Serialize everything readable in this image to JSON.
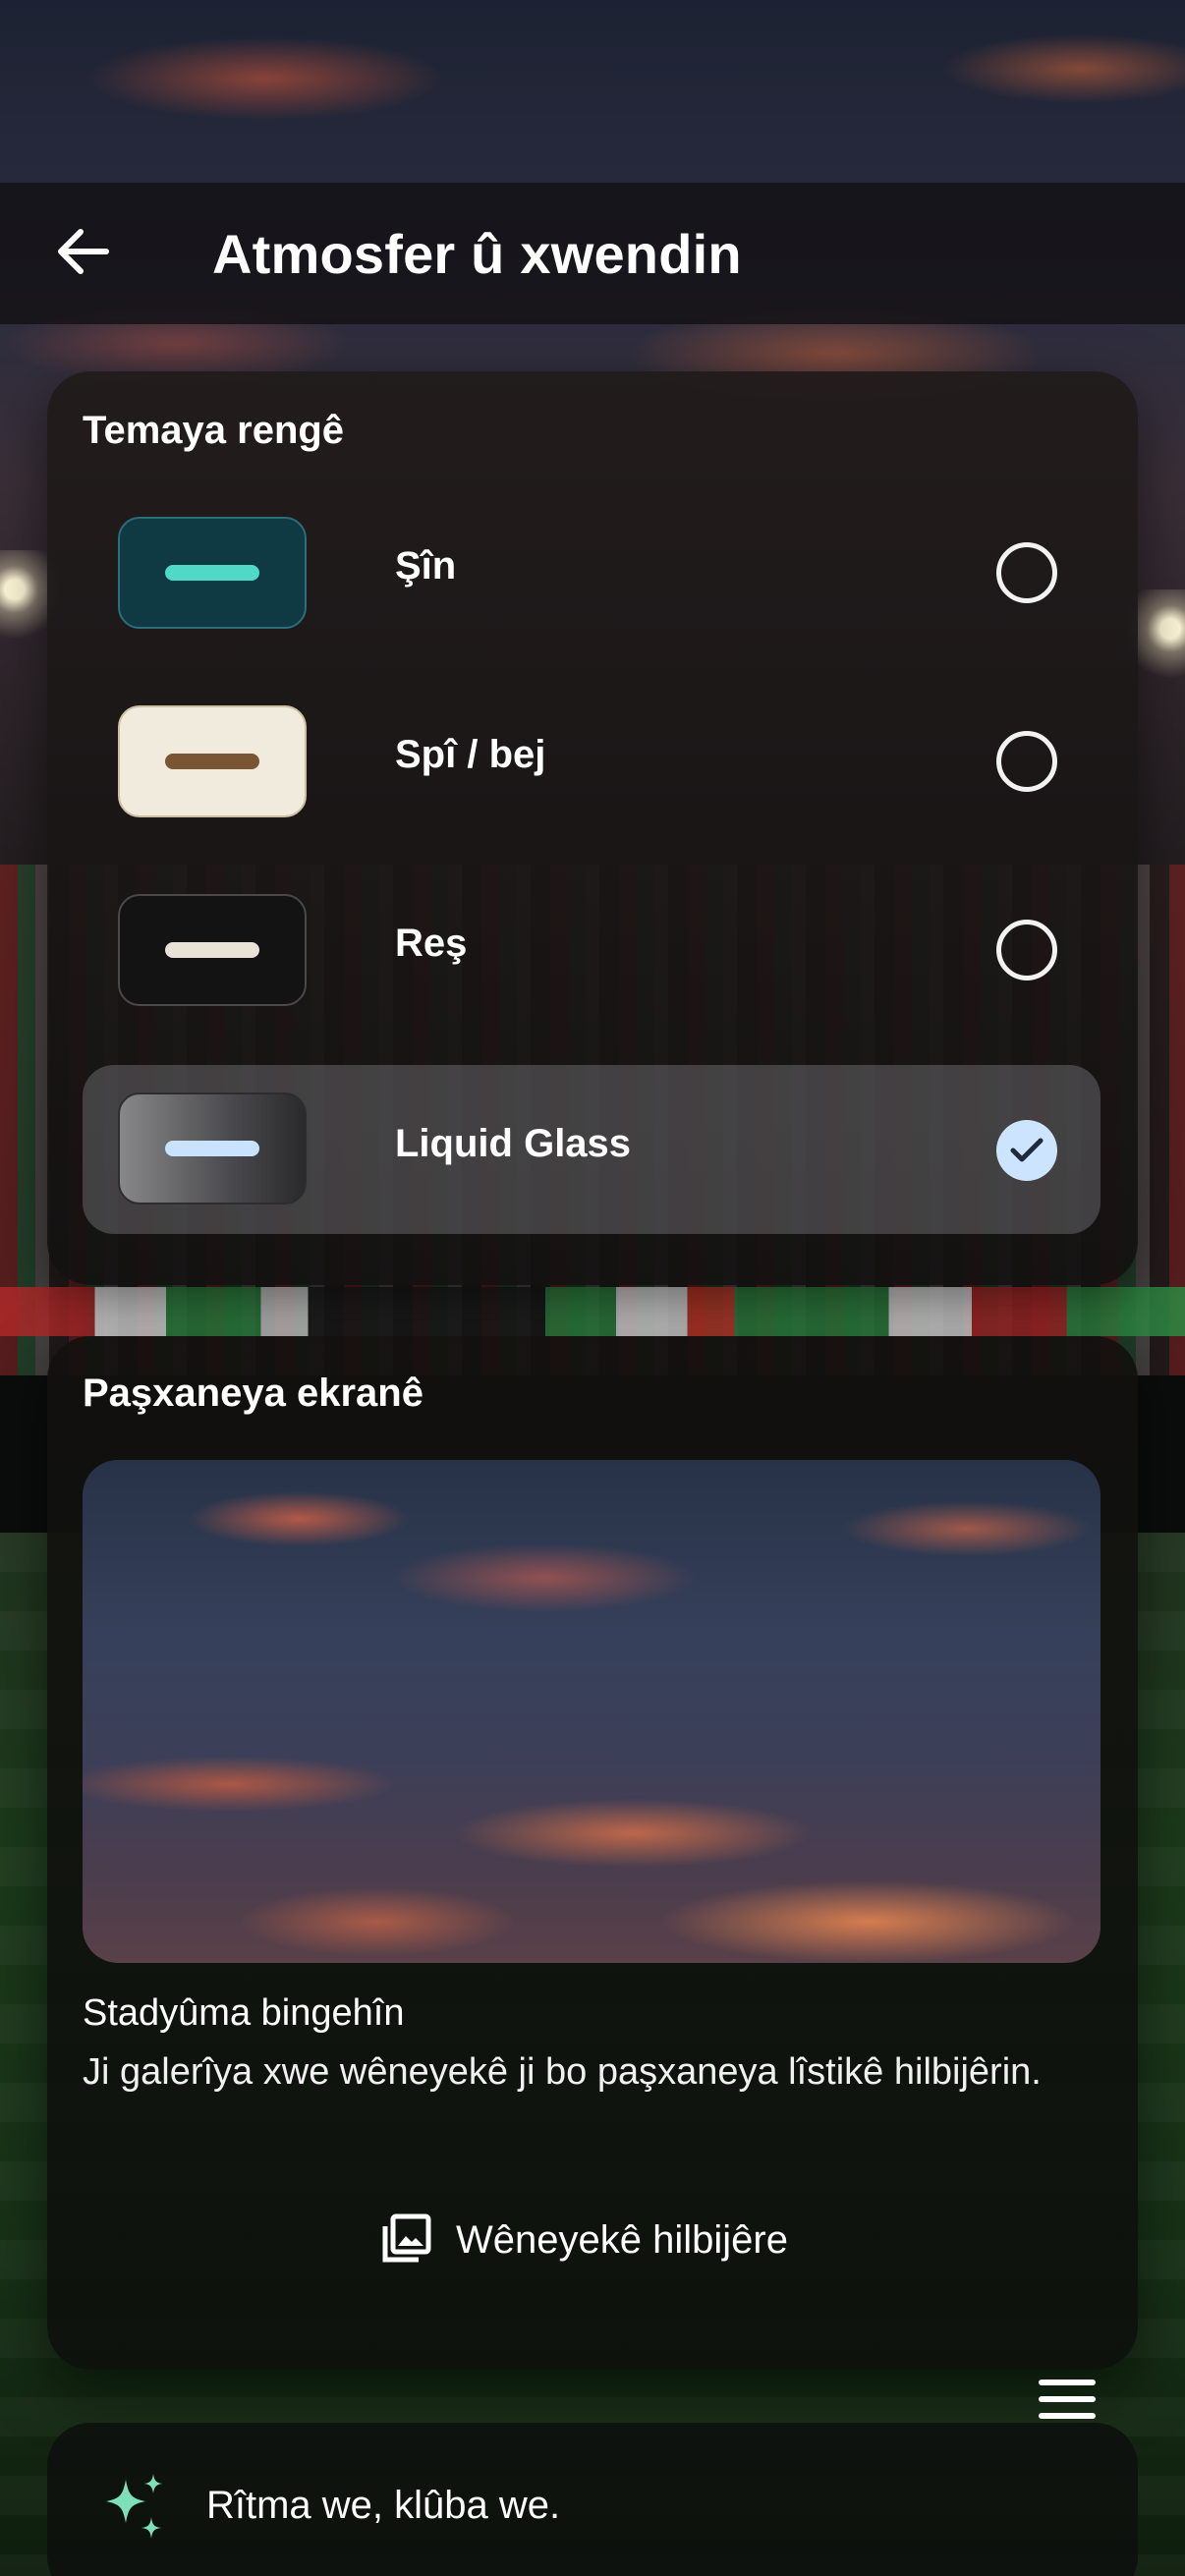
{
  "header": {
    "back_icon": "arrow-left-icon",
    "title": "Atmosfer û xwendin"
  },
  "theme_card": {
    "title": "Temaya rengê",
    "options": [
      {
        "label": "Şîn",
        "selected": false,
        "swatch_bg": "#0f3a44",
        "swatch_bar": "#4fd9c6"
      },
      {
        "label": "Spî / bej",
        "selected": false,
        "swatch_bg": "#f1ebdd",
        "swatch_bar": "#7a5534"
      },
      {
        "label": "Reş",
        "selected": false,
        "swatch_bg": "#141313",
        "swatch_bar": "#e8e3d6"
      },
      {
        "label": "Liquid Glass",
        "selected": true,
        "swatch_bg": "#555558",
        "swatch_bar": "#c9e2ff"
      }
    ]
  },
  "preview_card": {
    "title": "Paşxaneya ekranê",
    "caption": "Stadyûma bingehîn",
    "description": "Ji galerîya xwe wêneyekê ji bo paşxaneya lîstikê hilbijêrin.",
    "pick_icon": "image-gallery-icon",
    "pick_label": "Wêneyekê hilbijêre"
  },
  "menu": {
    "icon": "hamburger-menu-icon"
  },
  "footer": {
    "icon": "sparkle-icon",
    "text": "Rîtma we, klûba we."
  },
  "colors": {
    "accent_check": "#cde4ff",
    "sparkle": "#7ee0b8"
  }
}
